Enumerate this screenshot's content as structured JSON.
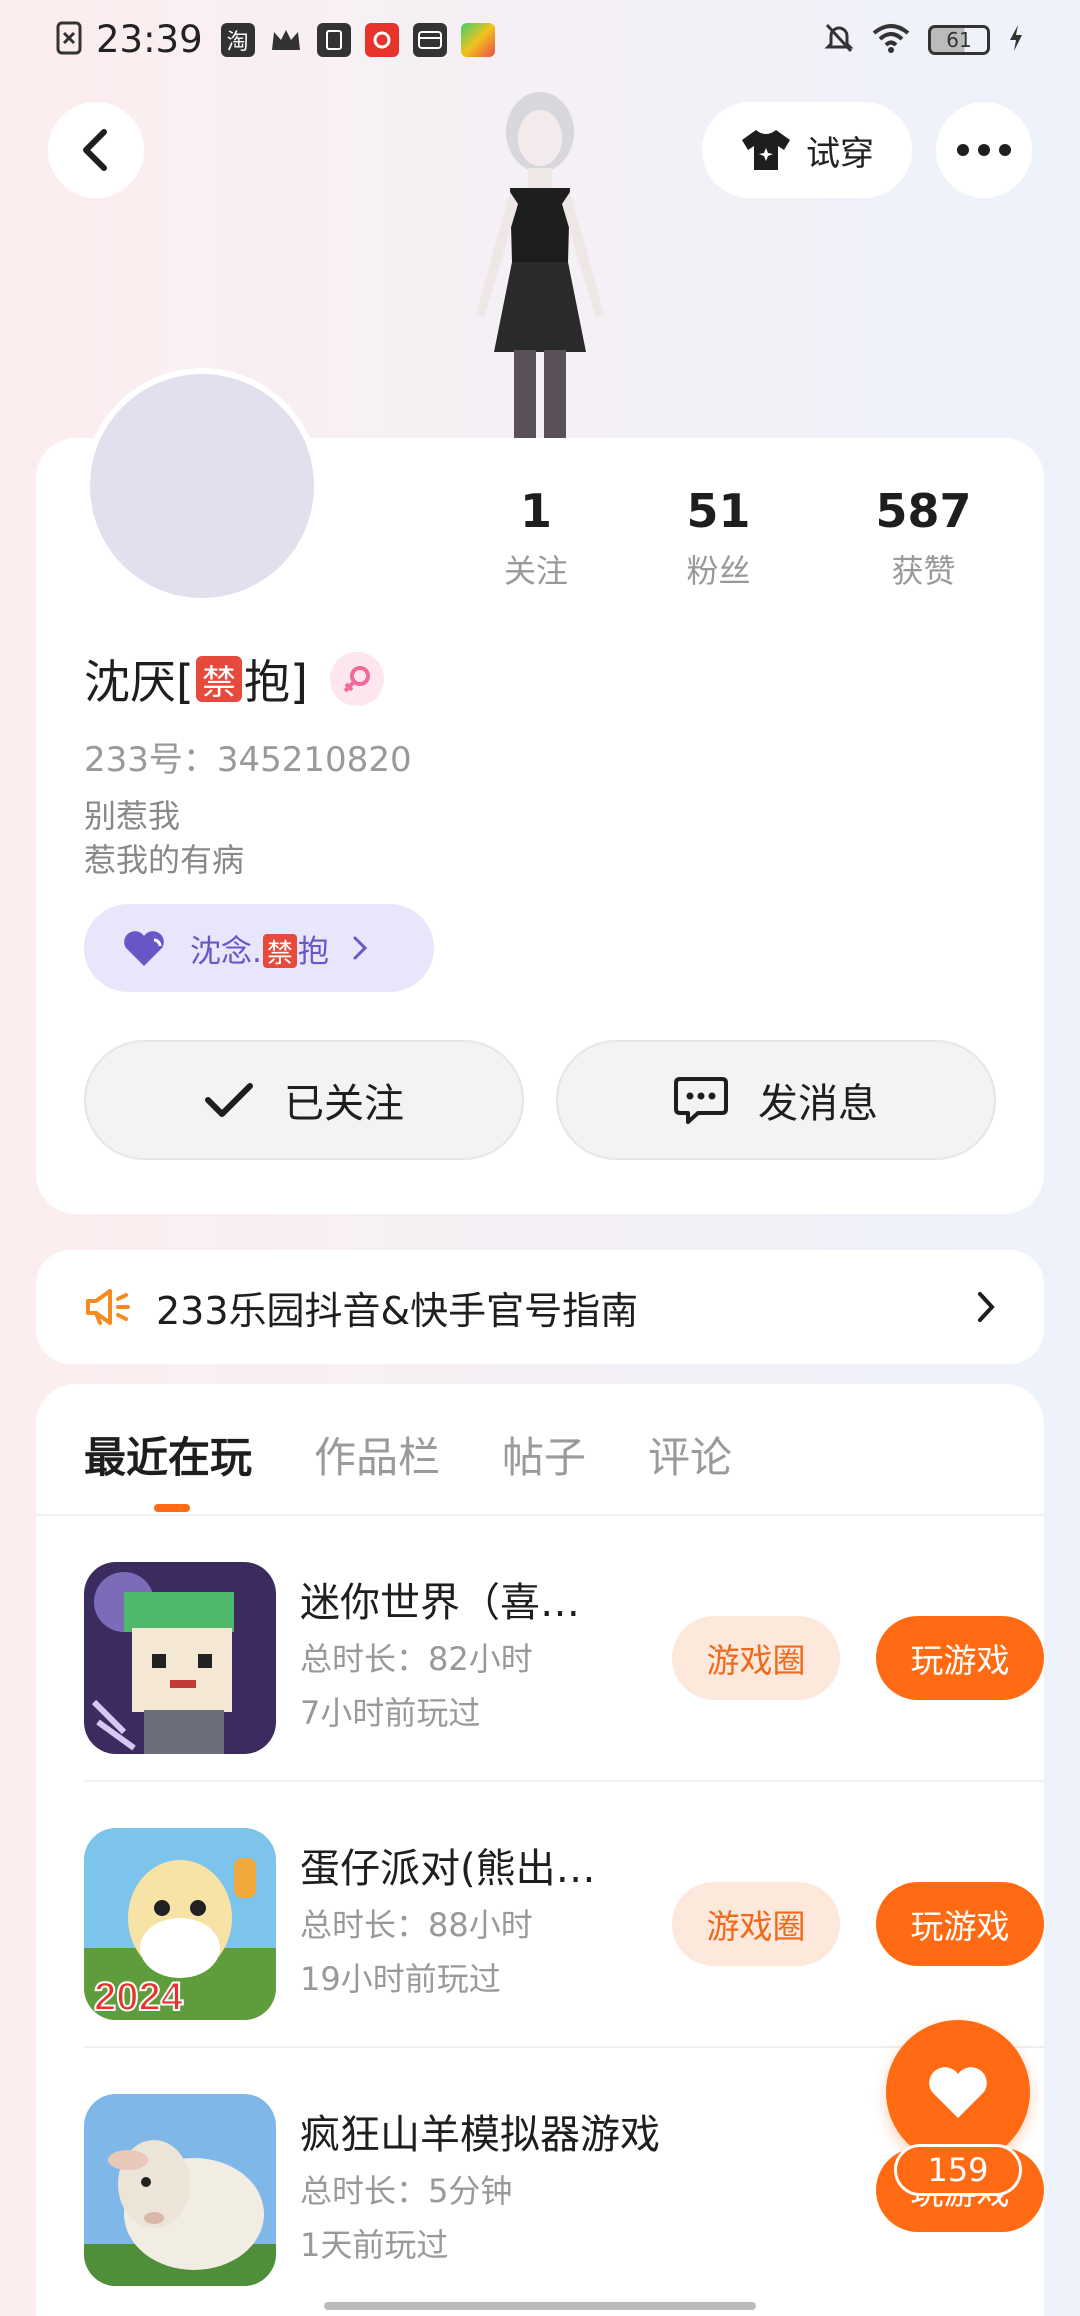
{
  "status_bar": {
    "time": "23:39",
    "battery": "61"
  },
  "header": {
    "tryon_label": "试穿"
  },
  "profile": {
    "stats": [
      {
        "value": "1",
        "label": "关注"
      },
      {
        "value": "51",
        "label": "粉丝"
      },
      {
        "value": "587",
        "label": "获赞"
      }
    ],
    "name_part1": "沈厌[",
    "name_ban": "禁",
    "name_part2": "抱]",
    "uid": "233号：345210820",
    "bio_line1": "别惹我",
    "bio_line2": "惹我的有病",
    "family_part1": "沈念.",
    "family_ban": "禁",
    "family_part2": "抱",
    "follow_label": "已关注",
    "message_label": "发消息"
  },
  "notice": {
    "text": "233乐园抖音&快手官号指南"
  },
  "tabs": [
    "最近在玩",
    "作品栏",
    "帖子",
    "评论"
  ],
  "games": [
    {
      "title": "迷你世界（喜…",
      "duration": "总时长：82小时",
      "last_played": "7小时前玩过",
      "circle_label": "游戏圈",
      "play_label": "玩游戏"
    },
    {
      "title": "蛋仔派对(熊出…",
      "duration": "总时长：88小时",
      "last_played": "19小时前玩过",
      "circle_label": "游戏圈",
      "play_label": "玩游戏"
    },
    {
      "title": "疯狂山羊模拟器游戏",
      "duration": "总时长：5分钟",
      "last_played": "1天前玩过",
      "play_label": "玩游戏"
    }
  ],
  "like": {
    "count": "159"
  },
  "colors": {
    "accent": "#ff6a13",
    "accent_light": "#fde8dc",
    "family_chip_bg": "#e9e6fb",
    "family_chip_text": "#6b56c8"
  }
}
